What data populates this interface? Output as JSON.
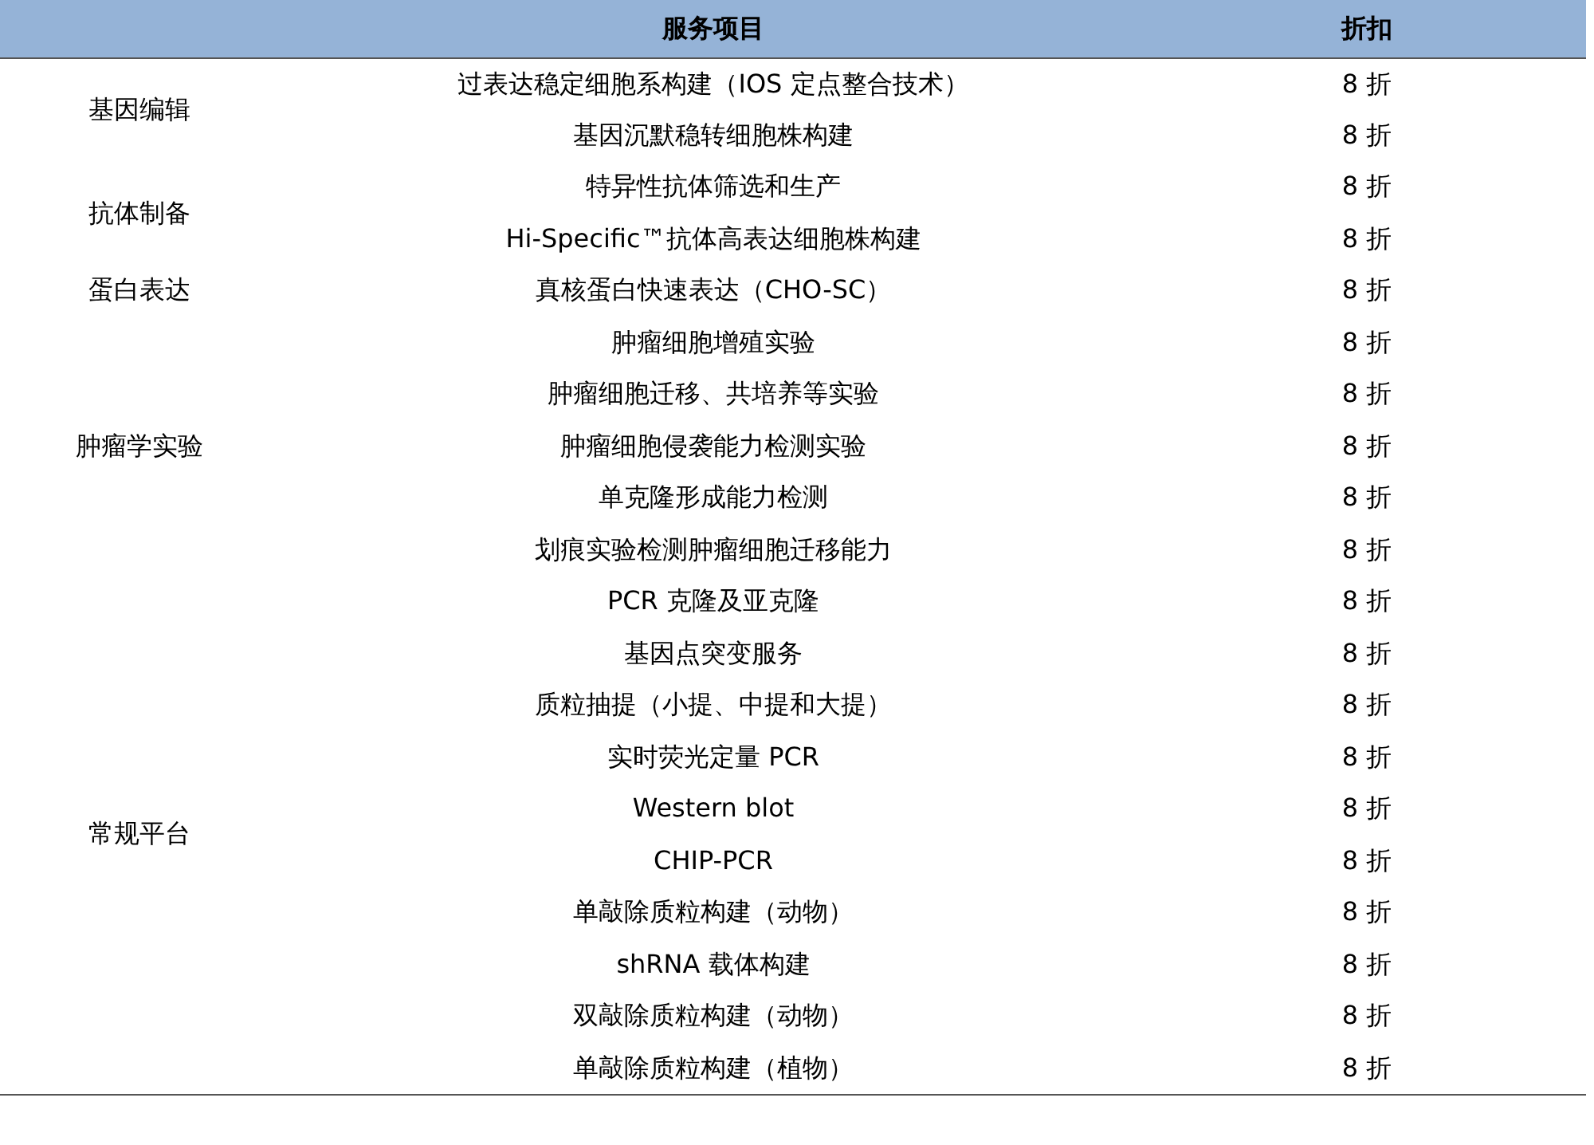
{
  "table": {
    "columns": [
      "",
      "服务项目",
      "折扣"
    ],
    "groups": [
      {
        "category": "基因编辑",
        "rows": [
          {
            "service": "过表达稳定细胞系构建（IOS 定点整合技术）",
            "discount": "8 折"
          },
          {
            "service": "基因沉默稳转细胞株构建",
            "discount": "8 折"
          }
        ]
      },
      {
        "category": "抗体制备",
        "rows": [
          {
            "service": "特异性抗体筛选和生产",
            "discount": "8 折"
          },
          {
            "service": "Hi-Specific™抗体高表达细胞株构建",
            "discount": "8 折"
          }
        ]
      },
      {
        "category": "蛋白表达",
        "rows": [
          {
            "service": "真核蛋白快速表达（CHO-SC）",
            "discount": "8 折"
          }
        ]
      },
      {
        "category": "肿瘤学实验",
        "rows": [
          {
            "service": "肿瘤细胞增殖实验",
            "discount": "8 折"
          },
          {
            "service": "肿瘤细胞迁移、共培养等实验",
            "discount": "8 折"
          },
          {
            "service": "肿瘤细胞侵袭能力检测实验",
            "discount": "8 折"
          },
          {
            "service": "单克隆形成能力检测",
            "discount": "8 折"
          },
          {
            "service": "划痕实验检测肿瘤细胞迁移能力",
            "discount": "8 折"
          }
        ]
      },
      {
        "category": "常规平台",
        "rows": [
          {
            "service": "PCR 克隆及亚克隆",
            "discount": "8 折"
          },
          {
            "service": "基因点突变服务",
            "discount": "8 折"
          },
          {
            "service": "质粒抽提（小提、中提和大提）",
            "discount": "8 折"
          },
          {
            "service": "实时荧光定量 PCR",
            "discount": "8 折"
          },
          {
            "service": "Western blot",
            "discount": "8 折"
          },
          {
            "service": "CHIP-PCR",
            "discount": "8 折"
          },
          {
            "service": "单敲除质粒构建（动物）",
            "discount": "8 折"
          },
          {
            "service": "shRNA 载体构建",
            "discount": "8 折"
          },
          {
            "service": "双敲除质粒构建（动物）",
            "discount": "8 折"
          },
          {
            "service": "单敲除质粒构建（植物）",
            "discount": "8 折"
          }
        ]
      }
    ]
  }
}
